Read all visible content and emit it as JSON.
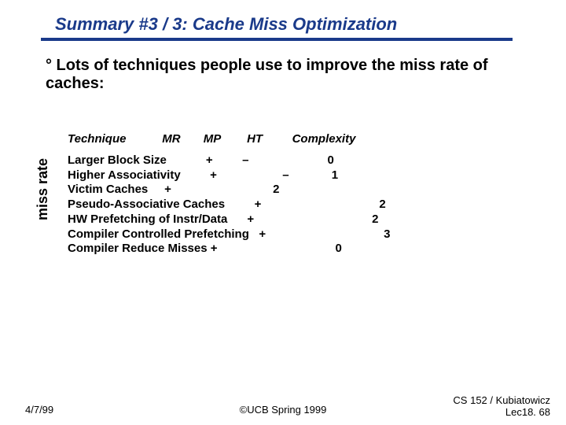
{
  "title": "Summary #3 / 3: Cache Miss Optimization",
  "bullet": "° Lots of techniques people use to improve the miss rate of caches:",
  "ylabel": "miss rate",
  "table": {
    "header": "Technique           MR       MP        HT         Complexity",
    "rows": "Larger Block Size            +         –                        0\nHigher Associativity         +                    –             1\nVictim Caches     +                               2\nPseudo-Associative Caches         +                                    2\nHW Prefetching of Instr/Data      +                                    2\nCompiler Controlled Prefetching   +                                    3\nCompiler Reduce Misses +                                    0"
  },
  "chart_data": {
    "type": "table",
    "title": "Cache Miss Optimization Techniques",
    "columns": [
      "Technique",
      "MR",
      "MP",
      "HT",
      "Complexity"
    ],
    "rows": [
      {
        "Technique": "Larger Block Size",
        "MR": "+",
        "MP": "–",
        "HT": "",
        "Complexity": "0"
      },
      {
        "Technique": "Higher Associativity",
        "MR": "+",
        "MP": "",
        "HT": "–",
        "Complexity": "1"
      },
      {
        "Technique": "Victim Caches",
        "MR": "+",
        "MP": "",
        "HT": "",
        "Complexity": "2"
      },
      {
        "Technique": "Pseudo-Associative Caches",
        "MR": "",
        "MP": "+",
        "HT": "",
        "Complexity": "2"
      },
      {
        "Technique": "HW Prefetching of Instr/Data",
        "MR": "",
        "MP": "+",
        "HT": "",
        "Complexity": "2"
      },
      {
        "Technique": "Compiler Controlled Prefetching",
        "MR": "",
        "MP": "+",
        "HT": "",
        "Complexity": "3"
      },
      {
        "Technique": "Compiler Reduce Misses",
        "MR": "+",
        "MP": "",
        "HT": "",
        "Complexity": "0"
      }
    ]
  },
  "footer": {
    "left": "4/7/99",
    "center": "©UCB Spring 1999",
    "right_line1": "CS 152 / Kubiatowicz",
    "right_line2": "Lec18. 68"
  }
}
